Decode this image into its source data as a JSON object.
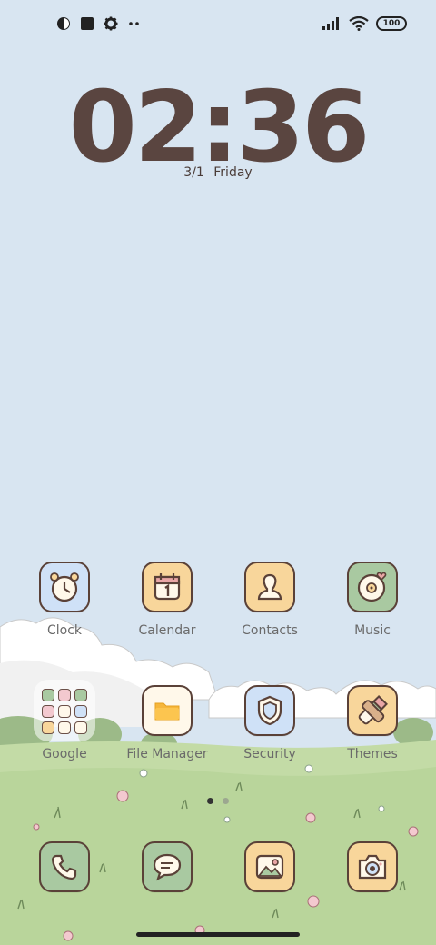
{
  "status_bar": {
    "battery": "100",
    "left_icons": [
      "app-icon",
      "square-icon",
      "gear-icon",
      "dots-icon"
    ],
    "right_icons": [
      "signal-icon",
      "wifi-icon",
      "battery-icon"
    ]
  },
  "lockscreen": {
    "time": "02:36",
    "date": "3/1 Friday"
  },
  "apps_row1": [
    {
      "label": "Clock",
      "icon": "alarm-clock-icon",
      "color": "#cfe1f7"
    },
    {
      "label": "Calendar",
      "icon": "calendar-icon",
      "color": "#f8d69b"
    },
    {
      "label": "Contacts",
      "icon": "person-icon",
      "color": "#f8d69b"
    },
    {
      "label": "Music",
      "icon": "vinyl-record-icon",
      "color": "#a9c9a1"
    }
  ],
  "apps_row2": [
    {
      "label": "Google",
      "icon": "folder-icon",
      "color": "#ffffff"
    },
    {
      "label": "File Manager",
      "icon": "folder-icon",
      "color": "#fff8ea"
    },
    {
      "label": "Security",
      "icon": "shield-icon",
      "color": "#cfe1f7"
    },
    {
      "label": "Themes",
      "icon": "paintbrush-icon",
      "color": "#f8d69b"
    }
  ],
  "dock": [
    {
      "icon": "phone-icon",
      "color": "#a9c9a1"
    },
    {
      "icon": "message-icon",
      "color": "#a9c9a1"
    },
    {
      "icon": "gallery-icon",
      "color": "#f8d69b"
    },
    {
      "icon": "camera-icon",
      "color": "#f8d69b"
    }
  ],
  "page_indicator": {
    "count": 2,
    "active": 0
  }
}
